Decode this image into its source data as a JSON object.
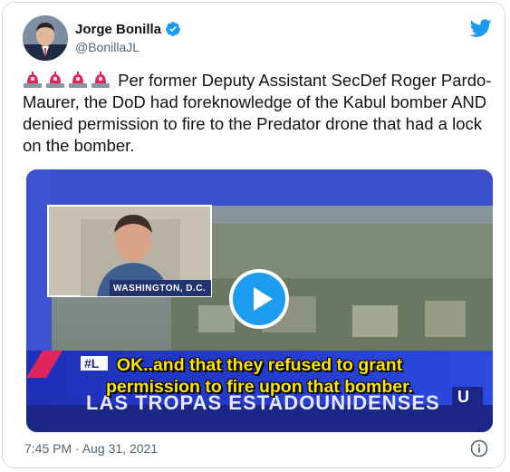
{
  "author": {
    "display_name": "Jorge Bonilla",
    "handle": "@BonillaJL"
  },
  "tweet": {
    "text": "Per former Deputy Assistant SecDef Roger Pardo-Maurer, the DoD had foreknowledge of the Kabul bomber AND denied permission to fire to the Predator drone that had a lock on the bomber.",
    "emoji": [
      "police-car-light-icon",
      "police-car-light-icon",
      "police-car-light-icon",
      "police-car-light-icon"
    ],
    "timestamp": "7:45 PM · Aug 31, 2021"
  },
  "video": {
    "location_label": "WASHINGTON, D.C.",
    "caption_line1": "OK..and that they refused to grant",
    "caption_line2": "permission to fire upon that bomber.",
    "lower_third": "LAS TROPAS ESTADOUNIDENSES"
  },
  "colors": {
    "brand": "#1d9bf0",
    "caption": "#ffe600",
    "muted": "#536471"
  }
}
